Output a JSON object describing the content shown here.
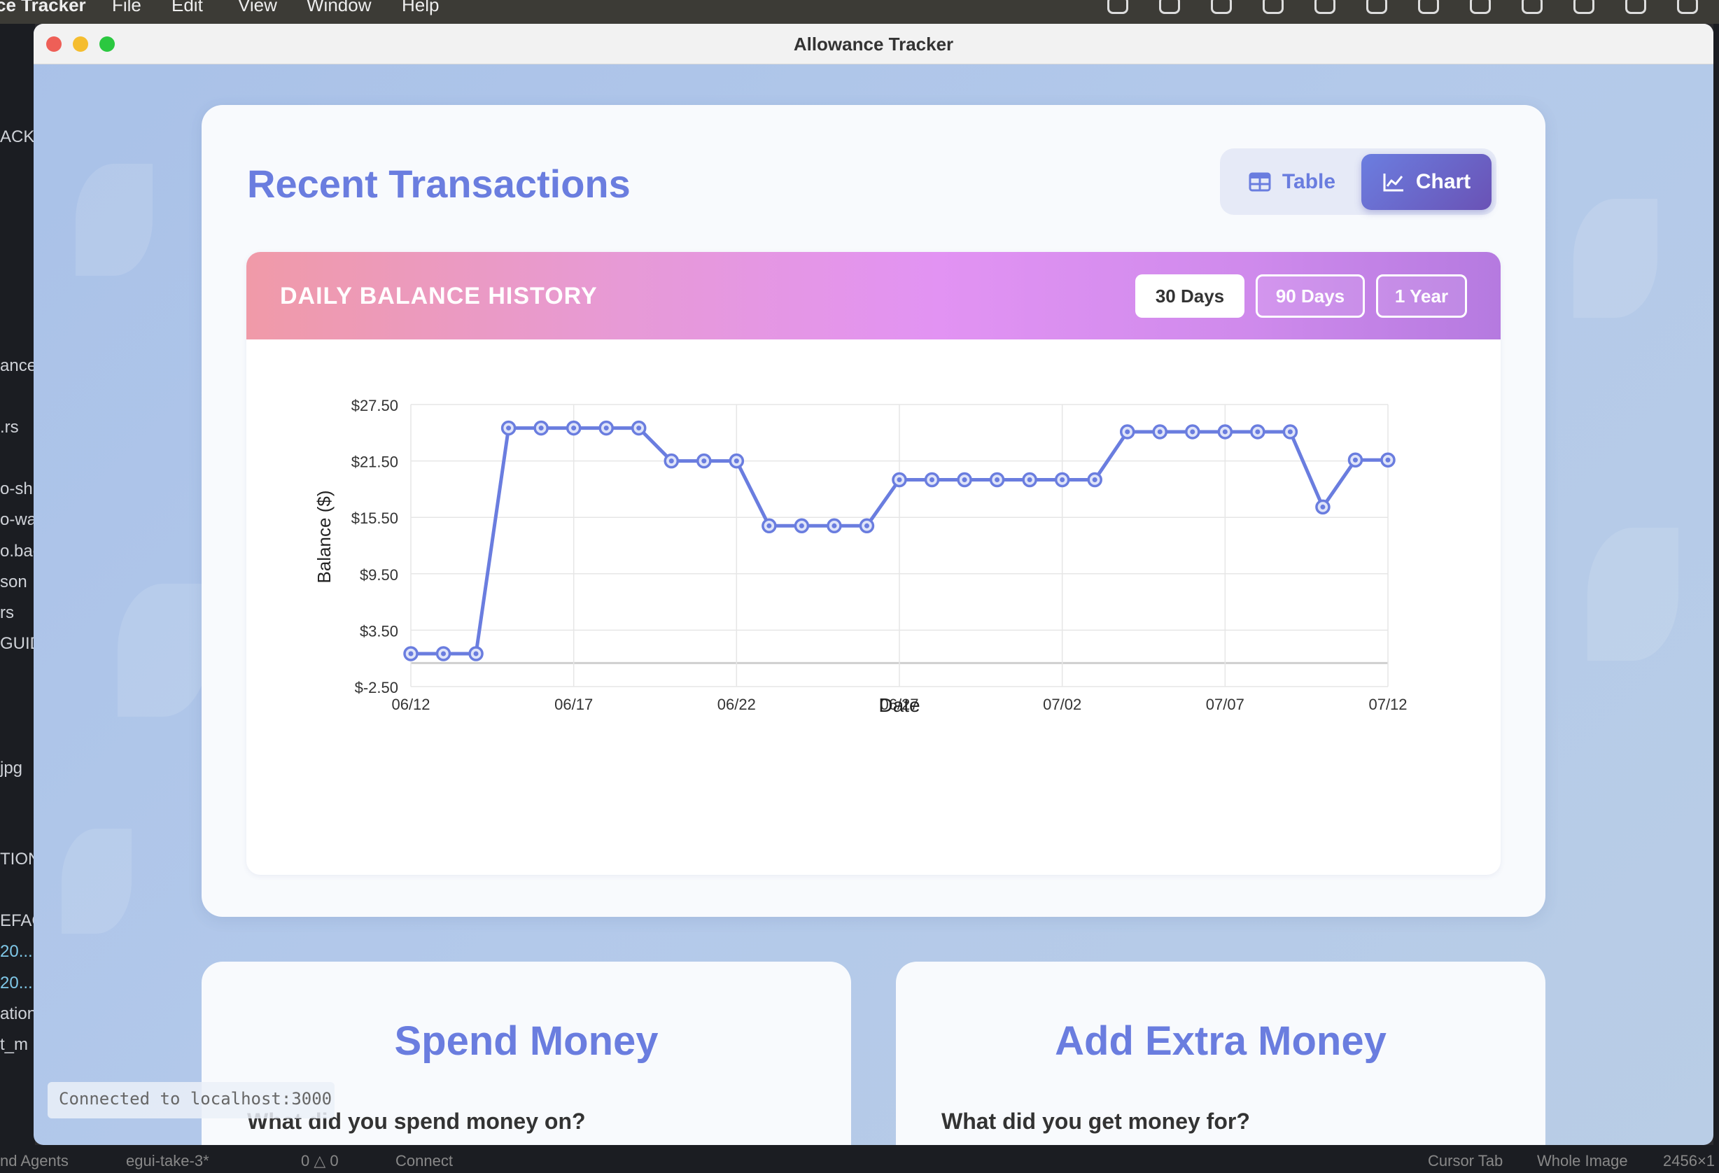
{
  "menubar": {
    "app_name": "ce Tracker",
    "items": [
      "File",
      "Edit",
      "View",
      "Window",
      "Help"
    ]
  },
  "window": {
    "title": "Allowance Tracker"
  },
  "transactions": {
    "title": "Recent Transactions",
    "view_toggle": {
      "table_label": "Table",
      "chart_label": "Chart",
      "active": "Chart"
    }
  },
  "chart_panel": {
    "heading": "DAILY BALANCE HISTORY",
    "ranges": [
      {
        "label": "30 Days",
        "active": true
      },
      {
        "label": "90 Days",
        "active": false
      },
      {
        "label": "1 Year",
        "active": false
      }
    ]
  },
  "chart_data": {
    "type": "line",
    "xlabel": "Date",
    "ylabel": "Balance ($)",
    "ylim": [
      -2.5,
      27.5
    ],
    "yticks": [
      "$27.50",
      "$21.50",
      "$15.50",
      "$9.50",
      "$3.50",
      "$-2.50"
    ],
    "ytick_values": [
      27.5,
      21.5,
      15.5,
      9.5,
      3.5,
      -2.5
    ],
    "xticks": [
      "06/12",
      "06/17",
      "06/22",
      "06/27",
      "07/02",
      "07/07",
      "07/12"
    ],
    "x": [
      "06/12",
      "06/13",
      "06/14",
      "06/15",
      "06/16",
      "06/17",
      "06/18",
      "06/19",
      "06/20",
      "06/21",
      "06/22",
      "06/23",
      "06/24",
      "06/25",
      "06/26",
      "06/27",
      "06/28",
      "06/29",
      "06/30",
      "07/01",
      "07/02",
      "07/03",
      "07/04",
      "07/05",
      "07/06",
      "07/07",
      "07/08",
      "07/09",
      "07/10",
      "07/11",
      "07/12"
    ],
    "values": [
      1.0,
      1.0,
      1.0,
      25.0,
      25.0,
      25.0,
      25.0,
      25.0,
      21.5,
      21.5,
      21.5,
      14.6,
      14.6,
      14.6,
      14.6,
      19.5,
      19.5,
      19.5,
      19.5,
      19.5,
      19.5,
      19.5,
      24.6,
      24.6,
      24.6,
      24.6,
      24.6,
      24.6,
      16.6,
      21.6,
      21.6
    ],
    "grid": true,
    "line_color": "#6a7ddf"
  },
  "spend": {
    "title": "Spend Money",
    "question": "What did you spend money on?"
  },
  "add": {
    "title": "Add Extra Money",
    "question": "What did you get money for?"
  },
  "connection": {
    "text": "Connected to localhost:3000"
  },
  "editor_strip": {
    "lines": [
      "ACK",
      "ance",
      ".rs",
      "o-sh",
      "o-wa",
      "o.bac",
      "son",
      "rs",
      "GUID",
      "jpg",
      "TION",
      "EFAC",
      "20...",
      "20...",
      "ation",
      "t_m"
    ]
  },
  "statusbar": {
    "left_items": [
      "nd Agents",
      "egui-take-3*",
      "0 △ 0",
      "Connect"
    ],
    "right_items": [
      "Cursor Tab",
      "Whole Image",
      "2456×1"
    ]
  }
}
